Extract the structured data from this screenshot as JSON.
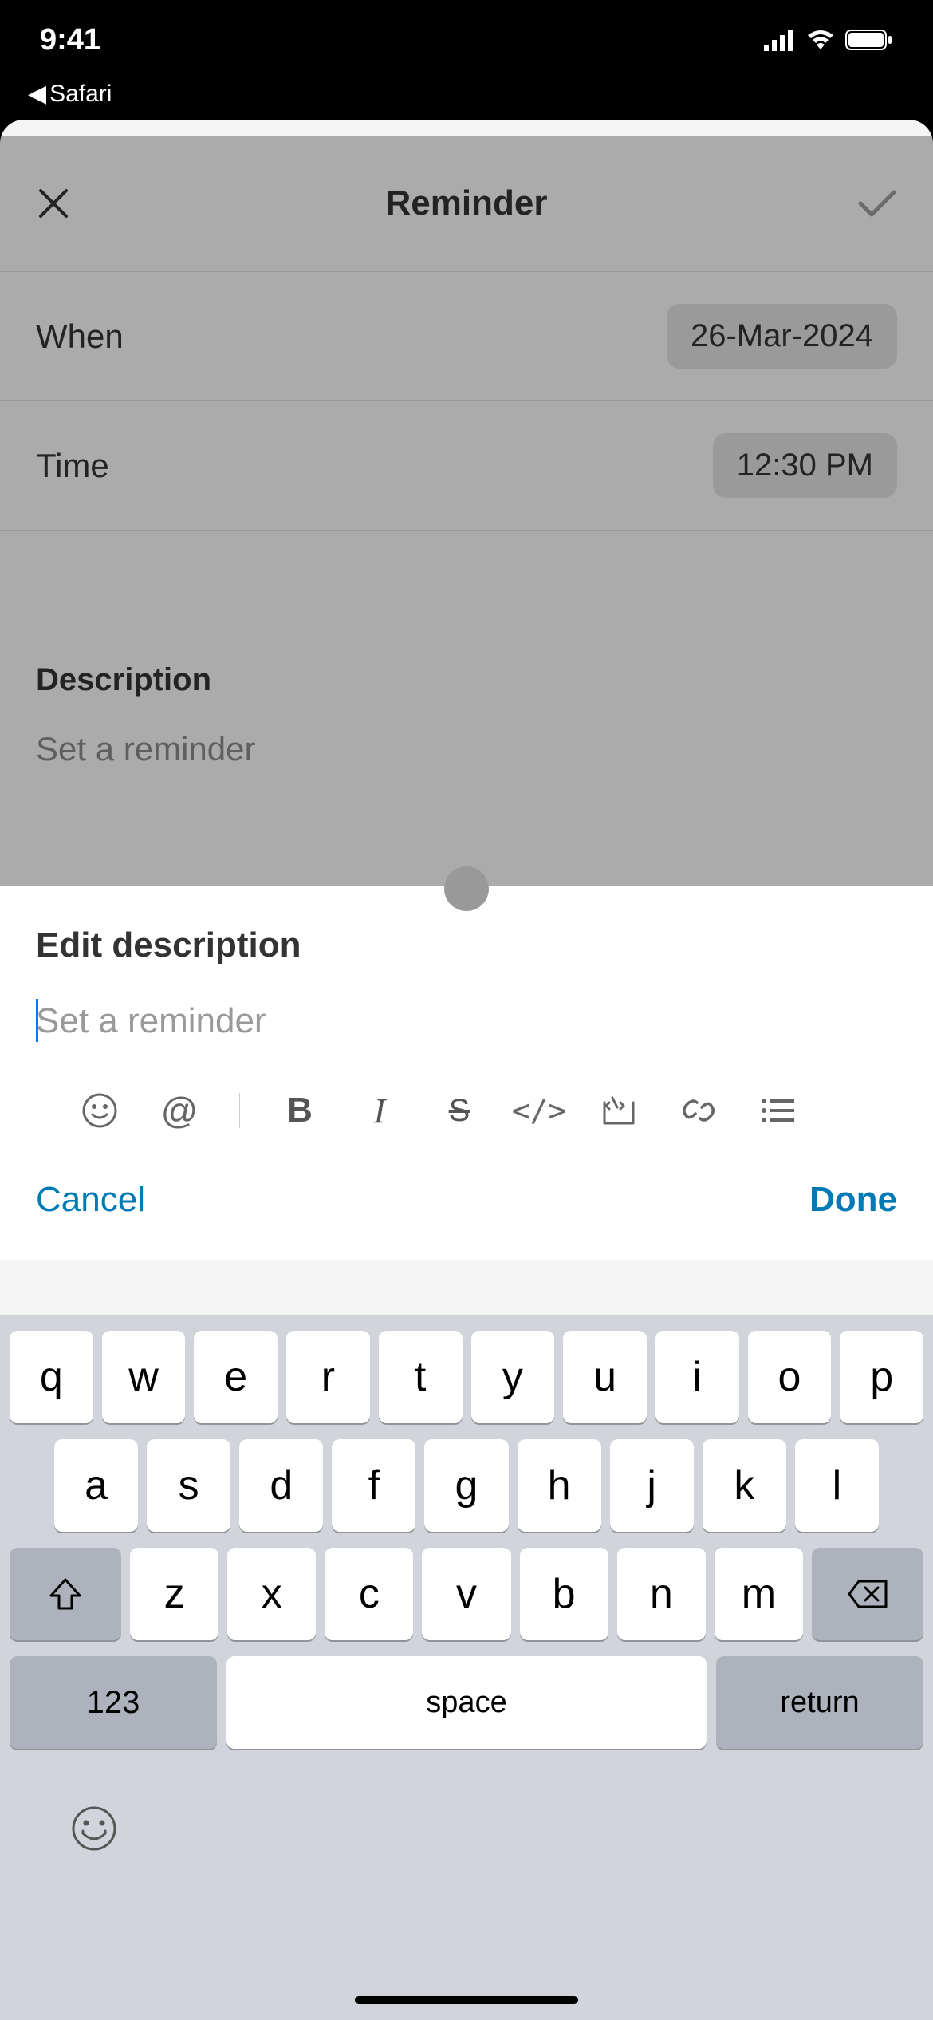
{
  "status": {
    "time": "9:41",
    "back_app": "Safari"
  },
  "modal": {
    "title": "Reminder",
    "when_label": "When",
    "when_value": "26-Mar-2024",
    "time_label": "Time",
    "time_value": "12:30 PM",
    "desc_label": "Description",
    "desc_placeholder": "Set a reminder"
  },
  "editor": {
    "title": "Edit description",
    "placeholder": "Set a reminder",
    "cancel": "Cancel",
    "done": "Done"
  },
  "keyboard": {
    "row1": [
      "q",
      "w",
      "e",
      "r",
      "t",
      "y",
      "u",
      "i",
      "o",
      "p"
    ],
    "row2": [
      "a",
      "s",
      "d",
      "f",
      "g",
      "h",
      "j",
      "k",
      "l"
    ],
    "row3": [
      "z",
      "x",
      "c",
      "v",
      "b",
      "n",
      "m"
    ],
    "numbers": "123",
    "space": "space",
    "return": "return"
  }
}
